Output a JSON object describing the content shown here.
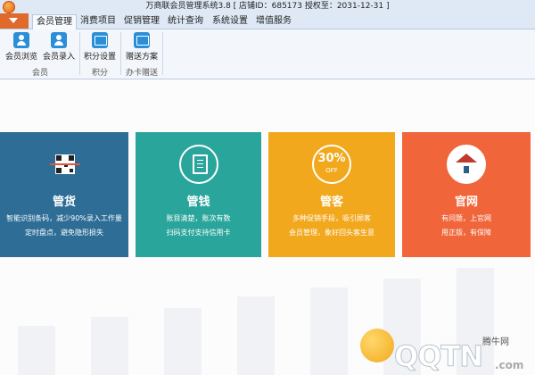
{
  "title_bar": {
    "title": "万商联会员管理系统3.8 [ 店铺ID：685173 授权至：2031-12-31 ]"
  },
  "ribbon": {
    "tabs": [
      {
        "label": "会员管理",
        "active": true
      },
      {
        "label": "消费项目",
        "active": false
      },
      {
        "label": "促销管理",
        "active": false
      },
      {
        "label": "统计查询",
        "active": false
      },
      {
        "label": "系统设置",
        "active": false
      },
      {
        "label": "增值服务",
        "active": false
      }
    ],
    "groups": [
      {
        "label": "会员",
        "buttons": [
          {
            "label": "会员浏览",
            "icon": "member-browse-icon"
          },
          {
            "label": "会员录入",
            "icon": "member-add-icon"
          }
        ]
      },
      {
        "label": "积分",
        "buttons": [
          {
            "label": "积分设置",
            "icon": "points-settings-icon"
          }
        ]
      },
      {
        "label": "办卡赠送",
        "buttons": [
          {
            "label": "赠送方案",
            "icon": "gift-plan-icon"
          }
        ]
      }
    ]
  },
  "cards": [
    {
      "title": "管货",
      "lines": [
        "智能识别条码，减少90%录入工作量",
        "定时盘点，避免隐形损失"
      ],
      "color": "#2d6d96",
      "icon": "barcode-scan-icon"
    },
    {
      "title": "管钱",
      "lines": [
        "账目清楚，账次有数",
        "扫码支付支持信用卡"
      ],
      "color": "#2aa59b",
      "icon": "document-edit-icon"
    },
    {
      "title": "管客",
      "lines": [
        "多种促销手段，吸引顾客",
        "会员管理，象好回头客生意"
      ],
      "color": "#f2a81d",
      "icon": "discount-badge-icon",
      "badge_main": "30%",
      "badge_sub": "OFF"
    },
    {
      "title": "官网",
      "lines": [
        "有问题，上官网",
        "用正版，有保障"
      ],
      "color": "#f0653a",
      "icon": "home-icon"
    }
  ],
  "watermark": {
    "brand": "QQTN",
    "small": "腾牛网",
    "domain": ".com"
  }
}
